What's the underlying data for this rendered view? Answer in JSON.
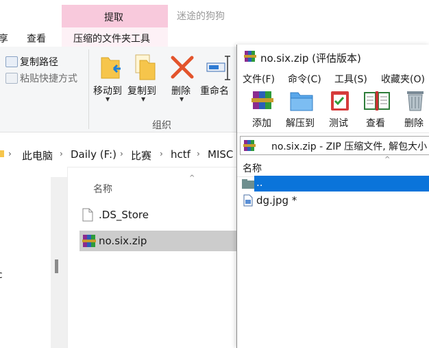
{
  "explorer": {
    "tabs": {
      "view": "查看",
      "share_partial": "享",
      "context_header": "提取",
      "context_tab": "压缩的文件夹工具",
      "window_title": "迷途的狗狗"
    },
    "ribbon": {
      "copy_path": "复制路径",
      "paste_shortcut": "粘贴快捷方式",
      "move_to": "移动到",
      "copy_to": "复制到",
      "delete": "删除",
      "rename": "重命名",
      "group_label": "组织"
    },
    "breadcrumb": [
      "此电脑",
      "Daily (F:)",
      "比赛",
      "hctf",
      "MISC"
    ],
    "file_list": {
      "header": "名称",
      "files": [
        ".DS_Store",
        "no.six.zip"
      ]
    },
    "nav_partial": "c"
  },
  "winrar": {
    "title": "no.six.zip (评估版本)",
    "menu": [
      "文件(F)",
      "命令(C)",
      "工具(S)",
      "收藏夹(O)"
    ],
    "toolbar": [
      "添加",
      "解压到",
      "测试",
      "查看",
      "删除"
    ],
    "path": "no.six.zip - ZIP 压缩文件, 解包大小",
    "list_header": "名称",
    "items": [
      "..",
      "dg.jpg *"
    ]
  },
  "colors": {
    "context_tab": "#f8c9dc",
    "selection_blue": "#0a74da",
    "selected_row": "#cccccc"
  }
}
